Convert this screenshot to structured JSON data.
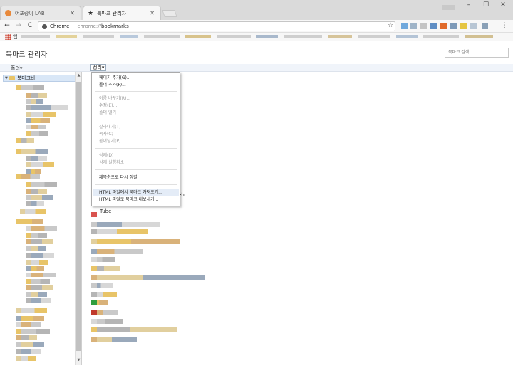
{
  "tabs": [
    {
      "label": "어포랑이 LAB"
    },
    {
      "label": "북마크 관리자"
    }
  ],
  "window": {
    "minimize": "–",
    "maximize": "☐",
    "close": "✕"
  },
  "toolbar": {
    "back": "←",
    "forward": "→",
    "reload": "C",
    "scheme_label": "Chrome",
    "url_prefix": "chrome://",
    "url_path": "bookmarks",
    "star": "☆"
  },
  "bookmarks_bar": {
    "apps_label": "앱"
  },
  "header": {
    "title": "북마크 관리자",
    "search_placeholder": "북마크 검색"
  },
  "subbar": {
    "folders_label": "폴더▾",
    "organize_label": "정리▾"
  },
  "tree": {
    "root_label": "북마크바"
  },
  "menu": {
    "items": [
      {
        "label": "페이지 추가(G)...",
        "enabled": true
      },
      {
        "label": "폴더 추가(F)...",
        "enabled": true
      },
      {
        "label": "이름 바꾸기(R)...",
        "enabled": false
      },
      {
        "label": "수정(E)...",
        "enabled": false
      },
      {
        "label": "폴더 열기",
        "enabled": false
      },
      {
        "label": "잘라내기(T)",
        "enabled": false
      },
      {
        "label": "복사(C)",
        "enabled": false
      },
      {
        "label": "붙여넣기(P)",
        "enabled": false
      },
      {
        "label": "삭제(D)",
        "enabled": false
      },
      {
        "label": "삭제 실행취소",
        "enabled": false
      },
      {
        "label": "제목순으로 다시 정렬",
        "enabled": true
      },
      {
        "label": "HTML 파일에서 북마크 가져오기...",
        "enabled": true,
        "highlighted": true
      },
      {
        "label": "HTML 파일로 북마크 내보내기...",
        "enabled": true
      }
    ]
  },
  "list": {
    "partial_texts": [
      "eb",
      "Tube"
    ]
  },
  "colors": {
    "tab_favicon": "#e8893b",
    "highlight": "#e4ecf7",
    "selected_tree": "#d9e7f7"
  }
}
